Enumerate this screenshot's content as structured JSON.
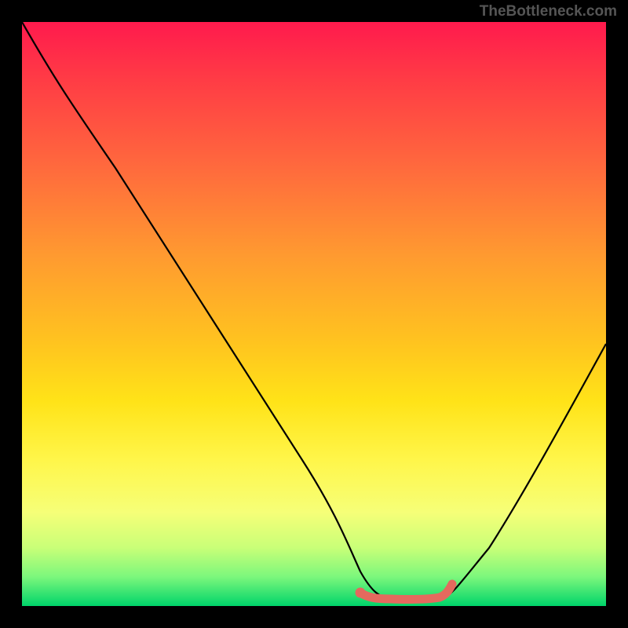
{
  "attribution": "TheBottleneck.com",
  "chart_data": {
    "type": "line",
    "title": "",
    "xlabel": "",
    "ylabel": "",
    "xlim": [
      0,
      100
    ],
    "ylim": [
      0,
      100
    ],
    "series": [
      {
        "name": "bottleneck-curve",
        "x": [
          0,
          8,
          16,
          24,
          32,
          40,
          48,
          54,
          58,
          62,
          64,
          66,
          68,
          70,
          72,
          76,
          80,
          84,
          88,
          92,
          96,
          100
        ],
        "values": [
          100,
          88,
          75,
          62,
          50,
          38,
          26,
          16,
          10,
          4,
          2,
          1,
          0.8,
          0.8,
          1,
          4,
          10,
          18,
          26,
          35,
          44,
          53
        ]
      }
    ],
    "optimal_range": {
      "x_start": 58,
      "x_end": 73,
      "y": 1.2
    },
    "colors": {
      "curve": "#000000",
      "optimal_marker": "#e4695e",
      "gradient_top": "#ff1a4d",
      "gradient_bottom": "#00d46a"
    }
  }
}
